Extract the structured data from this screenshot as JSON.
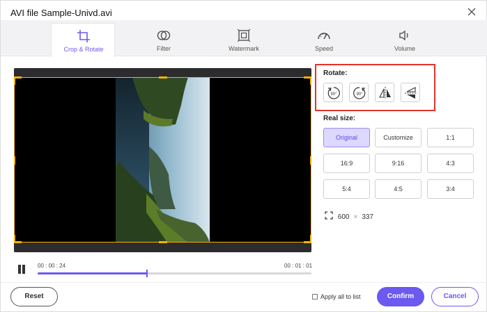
{
  "window": {
    "title": "AVI file Sample-Univd.avi"
  },
  "tabs": [
    {
      "label": "Crop & Rotate",
      "icon": "crop-icon",
      "active": true
    },
    {
      "label": "Filter",
      "icon": "filter-icon",
      "active": false
    },
    {
      "label": "Watermark",
      "icon": "watermark-icon",
      "active": false
    },
    {
      "label": "Speed",
      "icon": "speed-icon",
      "active": false
    },
    {
      "label": "Volume",
      "icon": "volume-icon",
      "active": false
    }
  ],
  "player": {
    "current_time": "00 : 00 : 24",
    "total_time": "00 : 01 : 01",
    "progress_fraction": 0.4
  },
  "rotate": {
    "title": "Rotate:",
    "buttons": [
      {
        "label": "90°",
        "icon": "rotate-left-icon"
      },
      {
        "label": "90°",
        "icon": "rotate-right-icon"
      },
      {
        "icon": "flip-horizontal-icon"
      },
      {
        "icon": "flip-vertical-icon"
      }
    ]
  },
  "real_size": {
    "title": "Real size:",
    "options": [
      "Original",
      "Customize",
      "1:1",
      "16:9",
      "9:16",
      "4:3",
      "5:4",
      "4:5",
      "3:4"
    ],
    "selected": "Original"
  },
  "dimensions": {
    "width": "600",
    "height": "337",
    "separator": "×"
  },
  "footer": {
    "reset_label": "Reset",
    "apply_all_label": "Apply all to list",
    "confirm_label": "Confirm",
    "cancel_label": "Cancel"
  },
  "colors": {
    "accent": "#6b59f0",
    "crop_frame": "#f5b400",
    "highlight_border": "#e0342a"
  }
}
